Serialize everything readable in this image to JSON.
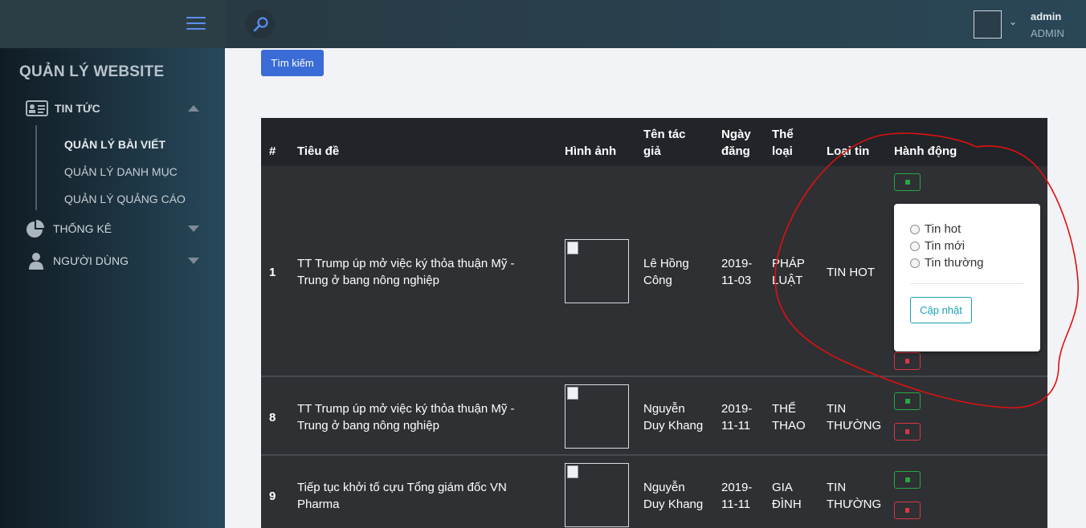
{
  "sidebar": {
    "title": "QUẢN LÝ WEBSITE",
    "menu": [
      {
        "label": "TIN TỨC",
        "icon": "id-card-icon",
        "expanded": true
      },
      {
        "label": "THỐNG KÊ",
        "icon": "pie-chart-icon",
        "expanded": false
      },
      {
        "label": "NGƯỜI DÙNG",
        "icon": "user-icon",
        "expanded": false
      }
    ],
    "submenu": [
      {
        "label": "QUẢN LÝ BÀI VIẾT",
        "active": true
      },
      {
        "label": "QUẢN LÝ DANH MỤC",
        "active": false
      },
      {
        "label": "QUẢN LÝ QUẢNG CÁO",
        "active": false
      }
    ]
  },
  "topbar": {
    "user": {
      "name": "admin",
      "role": "ADMIN"
    }
  },
  "search": {
    "button_label": "Tìm kiếm"
  },
  "table": {
    "headers": {
      "num": "#",
      "title": "Tiêu đề",
      "image": "Hình ảnh",
      "author_l1": "Tên tác",
      "author_l2": "giả",
      "date_l1": "Ngày",
      "date_l2": "đăng",
      "category_l1": "Thể",
      "category_l2": "loại",
      "type": "Loại tin",
      "actions": "Hành động"
    },
    "rows": [
      {
        "num": "1",
        "title_l1": "TT Trump úp mở việc ký thỏa thuận Mỹ -",
        "title_l2": "Trung ở bang nông nghiệp",
        "author_l1": "Lê Hồng",
        "author_l2": "Công",
        "date_l1": "2019-",
        "date_l2": "11-03",
        "category_l1": "PHÁP",
        "category_l2": "LUẬT",
        "type_l1": "TIN HOT",
        "type_l2": ""
      },
      {
        "num": "8",
        "title_l1": "TT Trump úp mở việc ký thỏa thuận Mỹ -",
        "title_l2": "Trung ở bang nông nghiệp",
        "author_l1": "Nguyễn",
        "author_l2": "Duy Khang",
        "date_l1": "2019-",
        "date_l2": "11-11",
        "category_l1": "THỂ",
        "category_l2": "THAO",
        "type_l1": "TIN",
        "type_l2": "THƯỜNG"
      },
      {
        "num": "9",
        "title_l1": "Tiếp tục khởi tố cựu Tổng giám đốc VN",
        "title_l2": "Pharma",
        "author_l1": "Nguyễn",
        "author_l2": "Duy Khang",
        "date_l1": "2019-",
        "date_l2": "11-11",
        "category_l1": "GIA",
        "category_l2": "ĐÌNH",
        "type_l1": "TIN",
        "type_l2": "THƯỜNG"
      }
    ]
  },
  "popover": {
    "options": [
      "Tin hot",
      "Tin mới",
      "Tin thường"
    ],
    "update_label": "Cập nhật"
  },
  "colors": {
    "accent": "#3a6bd6",
    "edit": "#28a745",
    "delete": "#dc3545",
    "info": "#17a2b8",
    "annotation": "#e01010"
  }
}
